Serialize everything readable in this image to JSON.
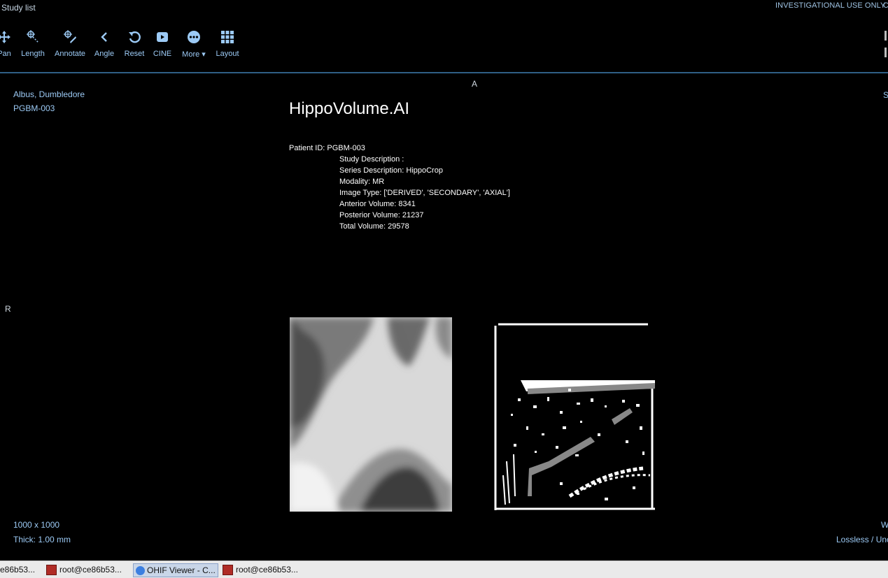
{
  "header": {
    "study_list": "Study list",
    "investigational": "INVESTIGATIONAL USE ONLY",
    "investigational_extra": "C"
  },
  "toolbar": {
    "items": [
      {
        "label": "Pan",
        "icon": "pan-icon"
      },
      {
        "label": "Length",
        "icon": "length-icon"
      },
      {
        "label": "Annotate",
        "icon": "annotate-icon"
      },
      {
        "label": "Angle",
        "icon": "angle-icon"
      },
      {
        "label": "Reset",
        "icon": "reset-icon"
      },
      {
        "label": "CINE",
        "icon": "cine-icon"
      },
      {
        "label": "More ▾",
        "icon": "more-icon"
      },
      {
        "label": "Layout",
        "icon": "layout-grid-icon"
      }
    ]
  },
  "viewport": {
    "orientation_top": "A",
    "orientation_left": "R",
    "top_right_cut": "S",
    "patient_name": "Albus, Dumbledore",
    "patient_id": "PGBM-003",
    "size": "1000 x 1000",
    "thickness": "Thick: 1.00 mm",
    "bottom_right_w": "W",
    "compression": "Lossless / Unc"
  },
  "report": {
    "title": "HippoVolume.AI",
    "patient_id_line": "Patient ID: PGBM-003",
    "study_description": "Study Description :",
    "series_description": "Series Description: HippoCrop",
    "modality": "Modality: MR",
    "image_type": "Image Type: ['DERIVED', 'SECONDARY', 'AXIAL']",
    "anterior_volume": "Anterior Volume: 8341",
    "posterior_volume": "Posterior Volume: 21237",
    "total_volume": "Total Volume: 29578"
  },
  "taskbar": {
    "items": [
      {
        "label": "e86b53..."
      },
      {
        "label": "root@ce86b53..."
      },
      {
        "label": "OHIF Viewer - C..."
      },
      {
        "label": "root@ce86b53..."
      }
    ]
  },
  "colors": {
    "accent": "#9ccaf5",
    "divider": "#2f5f85",
    "background": "#000000"
  }
}
